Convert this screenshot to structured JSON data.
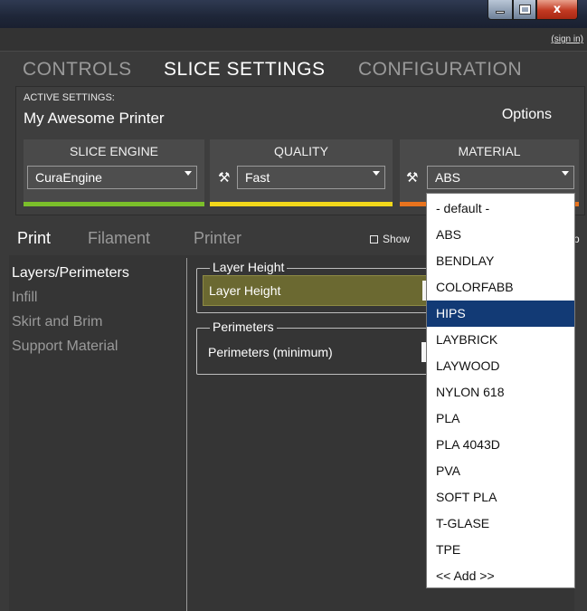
{
  "window": {
    "minimize_icon": "minimize-icon",
    "maximize_icon": "maximize-icon",
    "close_label": "x"
  },
  "header": {
    "signin": "(sign in)"
  },
  "main_tabs": [
    {
      "label": "CONTROLS",
      "active": false
    },
    {
      "label": "SLICE SETTINGS",
      "active": true
    },
    {
      "label": "CONFIGURATION",
      "active": false
    }
  ],
  "active_settings": {
    "label": "ACTIVE SETTINGS:",
    "value": "My Awesome Printer",
    "options_label": "Options"
  },
  "selectors": {
    "slice_engine": {
      "title": "SLICE ENGINE",
      "value": "CuraEngine",
      "bar_color": "#7bbf2a"
    },
    "quality": {
      "title": "QUALITY",
      "value": "Fast",
      "bar_color": "#f3d81a",
      "icon": "tools-icon"
    },
    "material": {
      "title": "MATERIAL",
      "value": "ABS",
      "bar_color": "#e8731e",
      "icon": "tools-icon"
    }
  },
  "sub_tabs": [
    {
      "label": "Print",
      "active": true
    },
    {
      "label": "Filament",
      "active": false
    },
    {
      "label": "Printer",
      "active": false
    }
  ],
  "show_advanced_label": "Show",
  "right_edge_label": "p",
  "categories": [
    {
      "label": "Layers/Perimeters",
      "active": true
    },
    {
      "label": "Infill",
      "active": false
    },
    {
      "label": "Skirt and Brim",
      "active": false
    },
    {
      "label": "Support Material",
      "active": false
    }
  ],
  "groups": {
    "layer_height": {
      "legend": "Layer Height",
      "setting": "Layer Height"
    },
    "perimeters": {
      "legend": "Perimeters",
      "setting": "Perimeters (minimum)"
    }
  },
  "material_options": [
    "- default -",
    "ABS",
    "BENDLAY",
    "COLORFABB",
    "HIPS",
    "LAYBRICK",
    "LAYWOOD",
    "NYLON 618",
    "PLA",
    "PLA 4043D",
    "PVA",
    "SOFT PLA",
    "T-GLASE",
    "TPE",
    "<< Add >>"
  ],
  "material_selected": "HIPS"
}
